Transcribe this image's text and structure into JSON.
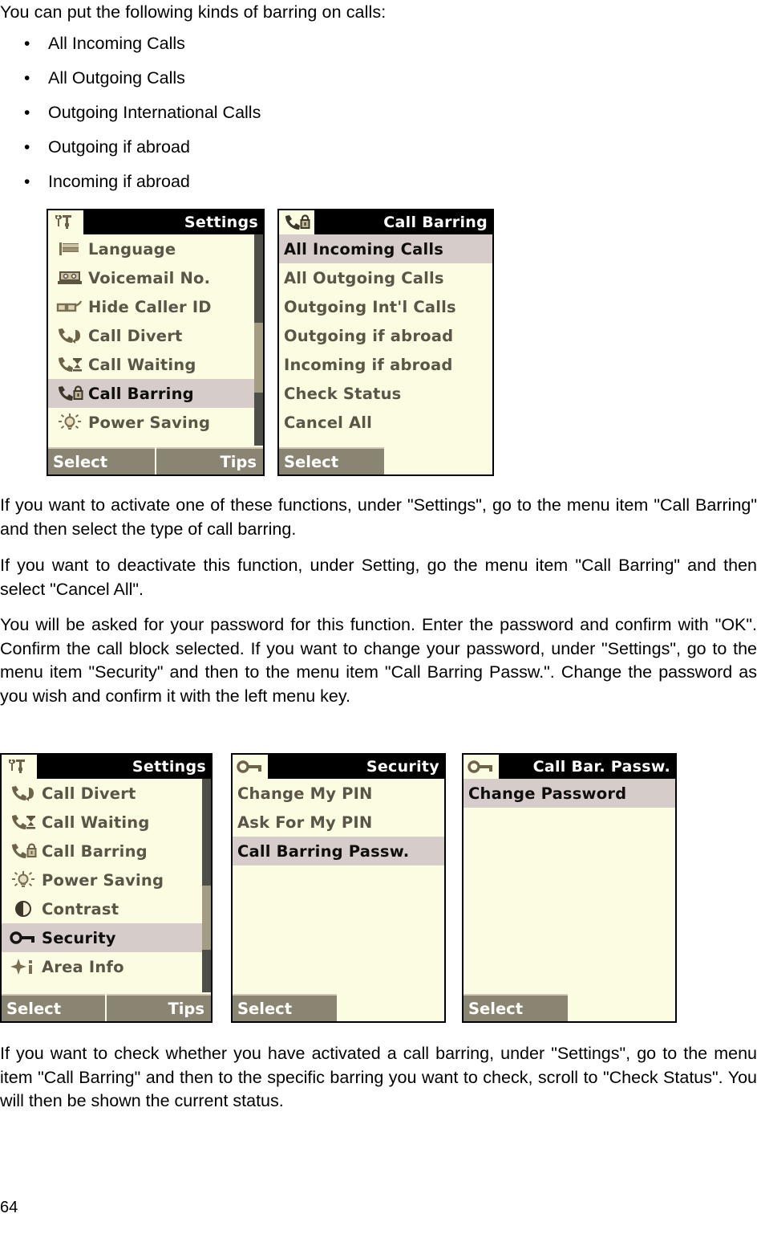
{
  "document": {
    "page_number": "64",
    "intro_line": "You can put the following kinds of barring on calls:",
    "bullets": [
      "All Incoming Calls",
      "All Outgoing Calls",
      "Outgoing International Calls",
      "Outgoing if abroad",
      "Incoming if abroad"
    ],
    "paragraphs": {
      "p1": "If you want to activate one of these functions, under \"Settings\", go to the menu item \"Call Barring\" and then select the type of call barring.",
      "p2": "If you want to deactivate this function, under Setting, go the menu item \"Call Barring\" and then select \"Cancel All\".",
      "p3": "You will be asked for your password for this function. Enter the password and confirm with \"OK\". Confirm the call block selected. If you want to change your password, under \"Settings\", go to the menu item \"Security\" and then to the menu item \"Call Barring Passw.\". Change the password as you wish and confirm it with the left menu key.",
      "p4": "If you want to check whether you have activated a call barring, under \"Settings\", go to the menu item \"Call Barring\" and then to the specific barring you want to check, scroll to \"Check Status\". You will then be shown the current status."
    }
  },
  "colors": {
    "screen_bg": "#fcfce2",
    "title_bar": "#000000",
    "title_text": "#fdfdfd",
    "highlight_row": "#d6cdca",
    "row_text": "#5a5547",
    "softkey_bg": "#8a8472",
    "softkey_text": "#ffffff",
    "scroll_track": "#4f4f4a",
    "scroll_thumb": "#a39b82"
  },
  "screens": {
    "settings_1": {
      "title": "Settings",
      "title_icon": "tools-icon",
      "items": [
        {
          "label": "Language",
          "icon": "flag-icon",
          "selected": false
        },
        {
          "label": "Voicemail No.",
          "icon": "answering-machine-icon",
          "selected": false
        },
        {
          "label": "Hide Caller ID",
          "icon": "glasses-icon",
          "selected": false
        },
        {
          "label": "Call Divert",
          "icon": "phone-divert-icon",
          "selected": false
        },
        {
          "label": "Call Waiting",
          "icon": "phone-hourglass-icon",
          "selected": false
        },
        {
          "label": "Call Barring",
          "icon": "phone-lock-icon",
          "selected": true
        },
        {
          "label": "Power Saving",
          "icon": "lightbulb-icon",
          "selected": false
        }
      ],
      "softkeys": {
        "left": "Select",
        "right": "Tips"
      },
      "scrollbar": {
        "visible": true,
        "thumb_top_pct": 42,
        "thumb_height_pct": 33
      }
    },
    "call_barring": {
      "title": "Call Barring",
      "title_icon": "phone-lock-icon",
      "items": [
        {
          "label": "All Incoming Calls",
          "selected": true
        },
        {
          "label": "All Outgoing Calls",
          "selected": false
        },
        {
          "label": "Outgoing Int'l Calls",
          "selected": false
        },
        {
          "label": "Outgoing if abroad",
          "selected": false
        },
        {
          "label": "Incoming if abroad",
          "selected": false
        },
        {
          "label": "Check Status",
          "selected": false
        },
        {
          "label": "Cancel All",
          "selected": false
        }
      ],
      "softkeys": {
        "left": "Select",
        "right": ""
      },
      "scrollbar": {
        "visible": false
      }
    },
    "settings_2": {
      "title": "Settings",
      "title_icon": "tools-icon",
      "items": [
        {
          "label": "Call Divert",
          "icon": "phone-divert-icon",
          "selected": false
        },
        {
          "label": "Call Waiting",
          "icon": "phone-hourglass-icon",
          "selected": false
        },
        {
          "label": "Call Barring",
          "icon": "phone-lock-icon",
          "selected": false
        },
        {
          "label": "Power Saving",
          "icon": "lightbulb-icon",
          "selected": false
        },
        {
          "label": "Contrast",
          "icon": "contrast-icon",
          "selected": false
        },
        {
          "label": "Security",
          "icon": "key-icon",
          "selected": true
        },
        {
          "label": "Area Info",
          "icon": "area-info-icon",
          "selected": false
        }
      ],
      "softkeys": {
        "left": "Select",
        "right": "Tips"
      },
      "scrollbar": {
        "visible": true,
        "thumb_top_pct": 50,
        "thumb_height_pct": 30
      }
    },
    "security": {
      "title": "Security",
      "title_icon": "key-icon",
      "items": [
        {
          "label": "Change My PIN",
          "selected": false
        },
        {
          "label": "Ask For My PIN",
          "selected": false
        },
        {
          "label": "Call Barring Passw.",
          "selected": true
        }
      ],
      "softkeys": {
        "left": "Select",
        "right": ""
      },
      "scrollbar": {
        "visible": false
      }
    },
    "call_bar_passw": {
      "title": "Call Bar. Passw.",
      "title_icon": "key-icon",
      "items": [
        {
          "label": "Change Password",
          "selected": true
        }
      ],
      "softkeys": {
        "left": "Select",
        "right": ""
      },
      "scrollbar": {
        "visible": false
      }
    }
  }
}
